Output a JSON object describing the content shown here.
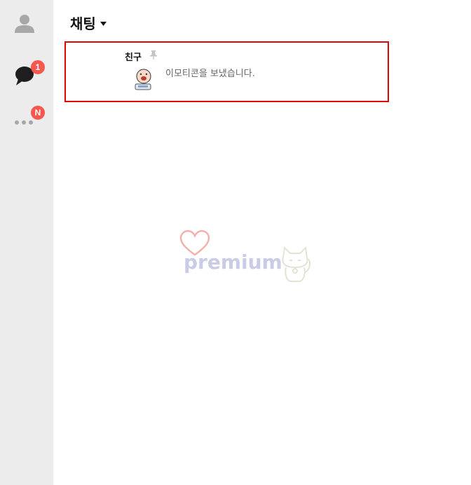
{
  "sidebar": {
    "items": [
      {
        "name": "friends",
        "icon": "person-icon"
      },
      {
        "name": "chats",
        "icon": "chat-bubble-icon",
        "badge": "1"
      },
      {
        "name": "more",
        "icon": "more-dots-icon",
        "badge": "N"
      }
    ],
    "badge_color": "#f7574d"
  },
  "header": {
    "title": "채팅"
  },
  "chats": [
    {
      "name": "친구",
      "pinned": true,
      "preview": "이모티콘을 보냈습니다."
    }
  ],
  "watermark": {
    "text": "premium"
  },
  "colors": {
    "highlight_border": "#e10600",
    "sidebar_bg": "#ececec"
  }
}
